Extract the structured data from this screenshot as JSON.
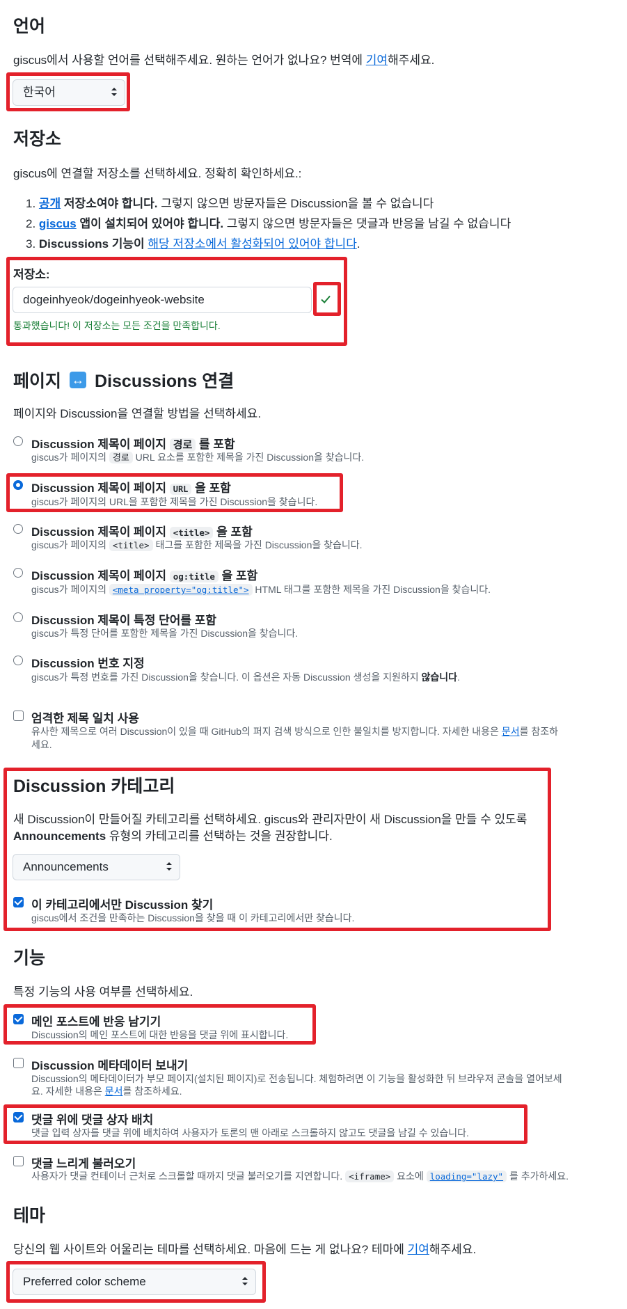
{
  "language": {
    "title": "언어",
    "desc_pre": "giscus에서 사용할 언어를 선택해주세요. 원하는 언어가 없나요? 번역에 ",
    "desc_link": "기여",
    "desc_post": "해주세요.",
    "selected": "한국어"
  },
  "repository": {
    "title": "저장소",
    "desc": "giscus에 연결할 저장소를 선택하세요. 정확히 확인하세요.:",
    "req1": {
      "num": "1. ",
      "link": "공개",
      "bold": " 저장소여야 합니다.",
      "text": " 그렇지 않으면 방문자들은 Discussion을 볼 수 없습니다"
    },
    "req2": {
      "num": "2. ",
      "link": "giscus",
      "bold": " 앱이 설치되어 있어야 합니다.",
      "text": " 그렇지 않으면 방문자들은 댓글과 반응을 남길 수 없습니다"
    },
    "req3": {
      "num": "3. ",
      "bold": "Discussions 기능이 ",
      "link": "해당 저장소에서 활성화되어 있어야 합니다",
      "text": "."
    },
    "field_label": "저장소:",
    "value": "dogeinhyeok/dogeinhyeok-website",
    "success": "통과했습니다! 이 저장소는 모든 조건을 만족합니다."
  },
  "mapping": {
    "title_pre": "페이지",
    "arrow": "↔",
    "title_post": "Discussions 연결",
    "desc": "페이지와 Discussion을 연결할 방법을 선택하세요.",
    "opt1": {
      "title_pre": "Discussion 제목이 페이지 ",
      "code": "경로",
      "title_post": " 를 포함",
      "desc_pre": "giscus가 페이지의 ",
      "desc_code": "경로",
      "desc_post": " URL 요소를 포함한 제목을 가진 Discussion을 찾습니다."
    },
    "opt2": {
      "title_pre": "Discussion 제목이 페이지 ",
      "code": "URL",
      "title_post": " 을 포함",
      "desc": "giscus가 페이지의 URL을 포함한 제목을 가진 Discussion을 찾습니다."
    },
    "opt3": {
      "title_pre": "Discussion 제목이 페이지 ",
      "code": "<title>",
      "title_post": " 을 포함",
      "desc_pre": "giscus가 페이지의 ",
      "desc_code": "<title>",
      "desc_post": " 태그를 포함한 제목을 가진 Discussion을 찾습니다."
    },
    "opt4": {
      "title_pre": "Discussion 제목이 페이지 ",
      "code": "og:title",
      "title_post": " 을 포함",
      "desc_pre": "giscus가 페이지의 ",
      "desc_code": "<meta property=\"og:title\">",
      "desc_post": " HTML 태그를 포함한 제목을 가진 Discussion을 찾습니다."
    },
    "opt5": {
      "title": "Discussion 제목이 특정 단어를 포함",
      "desc": "giscus가 특정 단어를 포함한 제목을 가진 Discussion을 찾습니다."
    },
    "opt6": {
      "title": "Discussion 번호 지정",
      "desc_pre": "giscus가 특정 번호를 가진 Discussion을 찾습니다. 이 옵션은 자동 Discussion 생성을 지원하지 ",
      "desc_bold": "않습니다",
      "desc_post": "."
    },
    "strict": {
      "title": "엄격한 제목 일치 사용",
      "desc1_pre": "유사한 제목으로 여러 Discussion이 있을 때 GitHub의 퍼지 검색 방식으로 인한 불일치를 방지합니다. 자세한 내용은 ",
      "desc1_link": "문서",
      "desc1_post": "를 참조하",
      "desc2": "세요."
    }
  },
  "category": {
    "title": "Discussion 카테고리",
    "desc1": "새 Discussion이 만들어질 카테고리를 선택하세요. giscus와 관리자만이 새 Discussion을 만들 수 있도록",
    "desc2_bold": "Announcements",
    "desc2_post": " 유형의 카테고리를 선택하는 것을 권장합니다.",
    "selected": "Announcements",
    "only_title": "이 카테고리에서만 Discussion 찾기",
    "only_desc": "giscus에서 조건을 만족하는 Discussion을 찾을 때 이 카테고리에서만 찾습니다."
  },
  "features": {
    "title": "기능",
    "desc": "특정 기능의 사용 여부를 선택하세요.",
    "f1": {
      "title": "메인 포스트에 반응 남기기",
      "desc": "Discussion의 메인 포스트에 대한 반응을 댓글 위에 표시합니다."
    },
    "f2": {
      "title": "Discussion 메타데이터 보내기",
      "desc1": "Discussion의 메타데이터가 부모 페이지(설치된 페이지)로 전송됩니다. 체험하려면 이 기능을 활성화한 뒤 브라우저 콘솔을 열어보세",
      "desc2_pre": "요. 자세한 내용은 ",
      "desc2_link": "문서",
      "desc2_post": "를 참조하세요."
    },
    "f3": {
      "title": "댓글 위에 댓글 상자 배치",
      "desc": "댓글 입력 상자를 댓글 위에 배치하여 사용자가 토론의 맨 아래로 스크롤하지 않고도 댓글을 남길 수 있습니다."
    },
    "f4": {
      "title": "댓글 느리게 불러오기",
      "desc_pre": "사용자가 댓글 컨테이너 근처로 스크롤할 때까지 댓글 불러오기를 지연합니다. ",
      "code1": "<iframe>",
      "desc_mid": " 요소에 ",
      "code2": "loading=\"lazy\"",
      "desc_post": " 를 추가하세요."
    }
  },
  "theme": {
    "title": "테마",
    "desc_pre": "당신의 웹 사이트와 어울리는 테마를 선택하세요. 마음에 드는 게 없나요? 테마에 ",
    "desc_link": "기여",
    "desc_post": "해주세요.",
    "selected": "Preferred color scheme"
  },
  "colors": {
    "accent": "#0969da",
    "success": "#1a7f37",
    "highlight": "#e3212b"
  }
}
